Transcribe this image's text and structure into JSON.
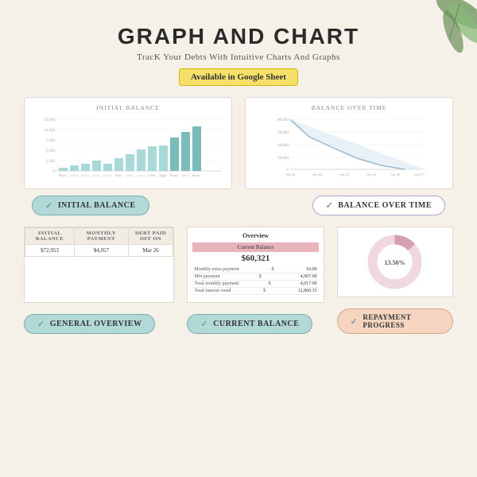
{
  "header": {
    "title": "GRAPH AND CHART",
    "subtitle": "TracK Your Debts With Intuitive Charts And Graphs",
    "badge": "Available in Google Sheet"
  },
  "chart1": {
    "title": "INITIAL BALANCE",
    "button": "INITIAL BALANCE",
    "yLabels": [
      "12,500",
      "10,000",
      "7,500",
      "5,000",
      "2,500",
      "0"
    ],
    "xLabels": [
      "Phone",
      "Credit Card 3",
      "Credit Card 4",
      "Student Loan",
      "Credit Card 1",
      "Boat",
      "Car 2",
      "Credit Card 5",
      "Cash",
      "Apple",
      "House",
      "Car 1",
      "House"
    ],
    "bars": [
      1,
      2,
      2,
      3,
      2,
      4,
      5,
      6,
      7,
      7,
      8,
      9,
      10
    ]
  },
  "chart2": {
    "title": "BALANCE OVER TIME",
    "button": "BALANCE OVER TIME",
    "yLabels": [
      "80,000",
      "60,000",
      "40,000",
      "20,000",
      "0"
    ],
    "xLabels": [
      "Jun-24",
      "Jan-25",
      "Jun-25",
      "Jan-26",
      "Jun-26",
      "Jan-27"
    ]
  },
  "table": {
    "headers": [
      "INITIAL BALANCE",
      "MONTHLY PAYMENT",
      "DEBT PAID OFF ON"
    ],
    "row": [
      "$72,953",
      "$4,057",
      "Mar 26"
    ]
  },
  "overview": {
    "title": "Overview",
    "current_balance_label": "Current Balance",
    "balance": "$60,321",
    "rows": [
      {
        "label": "Monthly extra payment",
        "symbol": "$",
        "value": "10.00"
      },
      {
        "label": "Min payment",
        "symbol": "$",
        "value": "4,007.00"
      },
      {
        "label": "Total monthly payment",
        "symbol": "$",
        "value": "4,017.00"
      },
      {
        "label": "Total interest owed",
        "symbol": "$",
        "value": "12,860.33"
      }
    ]
  },
  "donut": {
    "label": "13.50%",
    "percentage": 13.5
  },
  "buttons": {
    "initial_balance": "INITIAL BALANCE",
    "balance_over_time": "BALANCE OVER TIME",
    "general_overview": "GENERAL OVERVIEW",
    "current_balance": "CURRENT BALANCE",
    "repayment_progress": "REPAYMENT PROGRESS"
  }
}
